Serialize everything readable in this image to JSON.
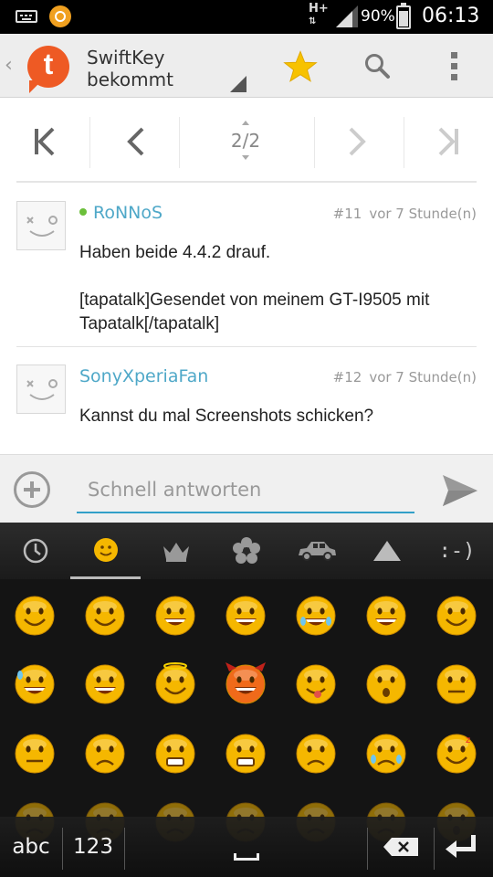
{
  "status_bar": {
    "network": "H+",
    "battery_text": "90%",
    "time": "06:13"
  },
  "action_bar": {
    "back_glyph": "‹",
    "logo_letter": "t",
    "title_line1": "SwiftKey",
    "title_line2": "bekommt",
    "icons": [
      "star-icon",
      "search-icon",
      "overflow-menu-icon"
    ]
  },
  "pager": {
    "first": "K",
    "prev": "<",
    "current": "2/2",
    "next": ">",
    "last": ">I"
  },
  "posts": [
    {
      "user": "RoNNoS",
      "online": true,
      "number": "#11",
      "time": "vor 7 Stunde(n)",
      "body": [
        "Haben beide 4.4.2 drauf.",
        "[tapatalk]Gesendet von meinem GT-I9505 mit Tapatalk[/tapatalk]"
      ]
    },
    {
      "user": "SonyXperiaFan",
      "online": false,
      "number": "#12",
      "time": "vor 7 Stunde(n)",
      "body": [
        "Kannst du mal Screenshots schicken?"
      ]
    }
  ],
  "reply": {
    "placeholder": "Schnell antworten"
  },
  "keyboard": {
    "categories": [
      "recent-icon",
      "smiley-icon",
      "crown-icon",
      "flower-icon",
      "car-icon",
      "triangle-icon",
      ":-)"
    ],
    "active_category": 1,
    "emoticon_label": ":-)",
    "abc_label": "abc",
    "num_label": "123",
    "accent_color": "#f5b700"
  }
}
